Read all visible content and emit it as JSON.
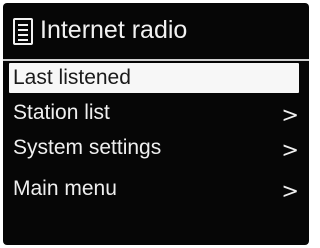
{
  "header": {
    "icon": "station-list-icon",
    "title": "Internet radio"
  },
  "menu": {
    "selected_index": 0,
    "items": [
      {
        "label": "Last listened",
        "arrow": ""
      },
      {
        "label": "Station list",
        "arrow": ">"
      },
      {
        "label": "System settings",
        "arrow": ">"
      },
      {
        "label": "Main menu",
        "arrow": ">"
      }
    ]
  },
  "colors": {
    "background": "#060606",
    "text": "#efefef",
    "highlight_bg": "#f7f7f7",
    "highlight_text": "#1a1a1a"
  }
}
